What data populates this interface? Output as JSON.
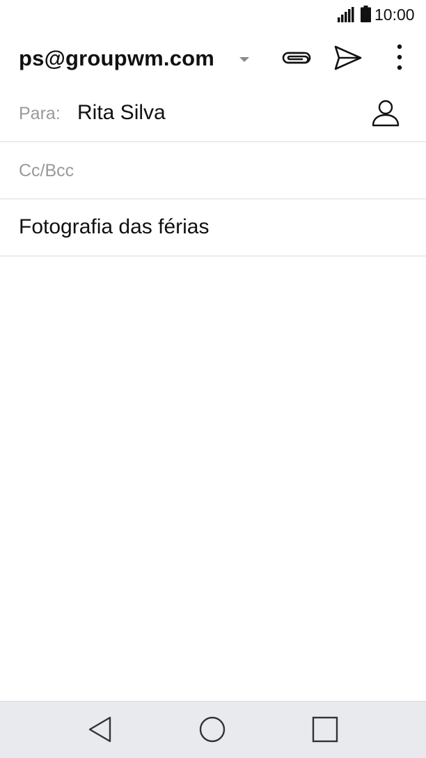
{
  "status_bar": {
    "time": "10:00",
    "icons": [
      "signal-icon",
      "battery-icon"
    ]
  },
  "toolbar": {
    "account": "ps@groupwm.com",
    "icons": [
      "dropdown-arrow-icon",
      "paperclip-icon",
      "send-icon",
      "more-vert-icon"
    ]
  },
  "compose": {
    "to_label": "Para:",
    "to_recipient": "Rita Silva",
    "cc_label": "Cc/Bcc",
    "subject": "Fotografia das férias",
    "contact_icon": "person-icon"
  },
  "nav_bar": {
    "icons": [
      "back-icon",
      "home-icon",
      "recent-apps-icon"
    ]
  },
  "colors": {
    "text": "#111111",
    "hint": "#9a9a9a",
    "divider": "#dcdcdc",
    "nav_background": "#e9eaee"
  }
}
